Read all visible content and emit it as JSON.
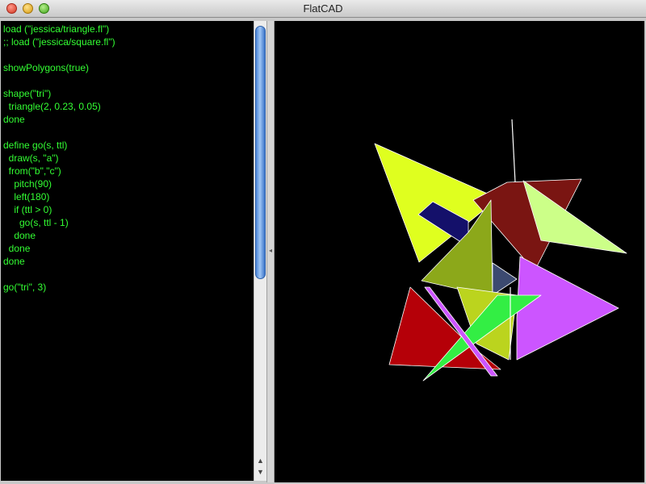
{
  "window": {
    "title": "FlatCAD"
  },
  "editor": {
    "lines": [
      "load (\"jessica/triangle.fl\")",
      ";; load (\"jessica/square.fl\")",
      "",
      "showPolygons(true)",
      "",
      "shape(\"tri\")",
      "  triangle(2, 0.23, 0.05)",
      "done",
      "",
      "define go(s, ttl)",
      "  draw(s, \"a\")",
      "  from(\"b\",\"c\")",
      "    pitch(90)",
      "    left(180)",
      "    if (ttl > 0)",
      "      go(s, ttl - 1)",
      "    done",
      "  done",
      "done",
      "",
      "go(\"tri\", 3)"
    ]
  },
  "scrollbar": {
    "up_arrow": "▲",
    "down_arrow": "▼"
  },
  "splitter": {
    "grip": "◂"
  },
  "colors": {
    "code_text": "#33ff33",
    "yellow": "#dfff1f",
    "olive": "#8ca81a",
    "maroon": "#7a1512",
    "light_green": "#ccff88",
    "navy": "#14106a",
    "violet": "#cc55ff",
    "red": "#b50008",
    "green": "#33ee44",
    "lime": "#bbd41e",
    "slate": "#3c4a70"
  }
}
